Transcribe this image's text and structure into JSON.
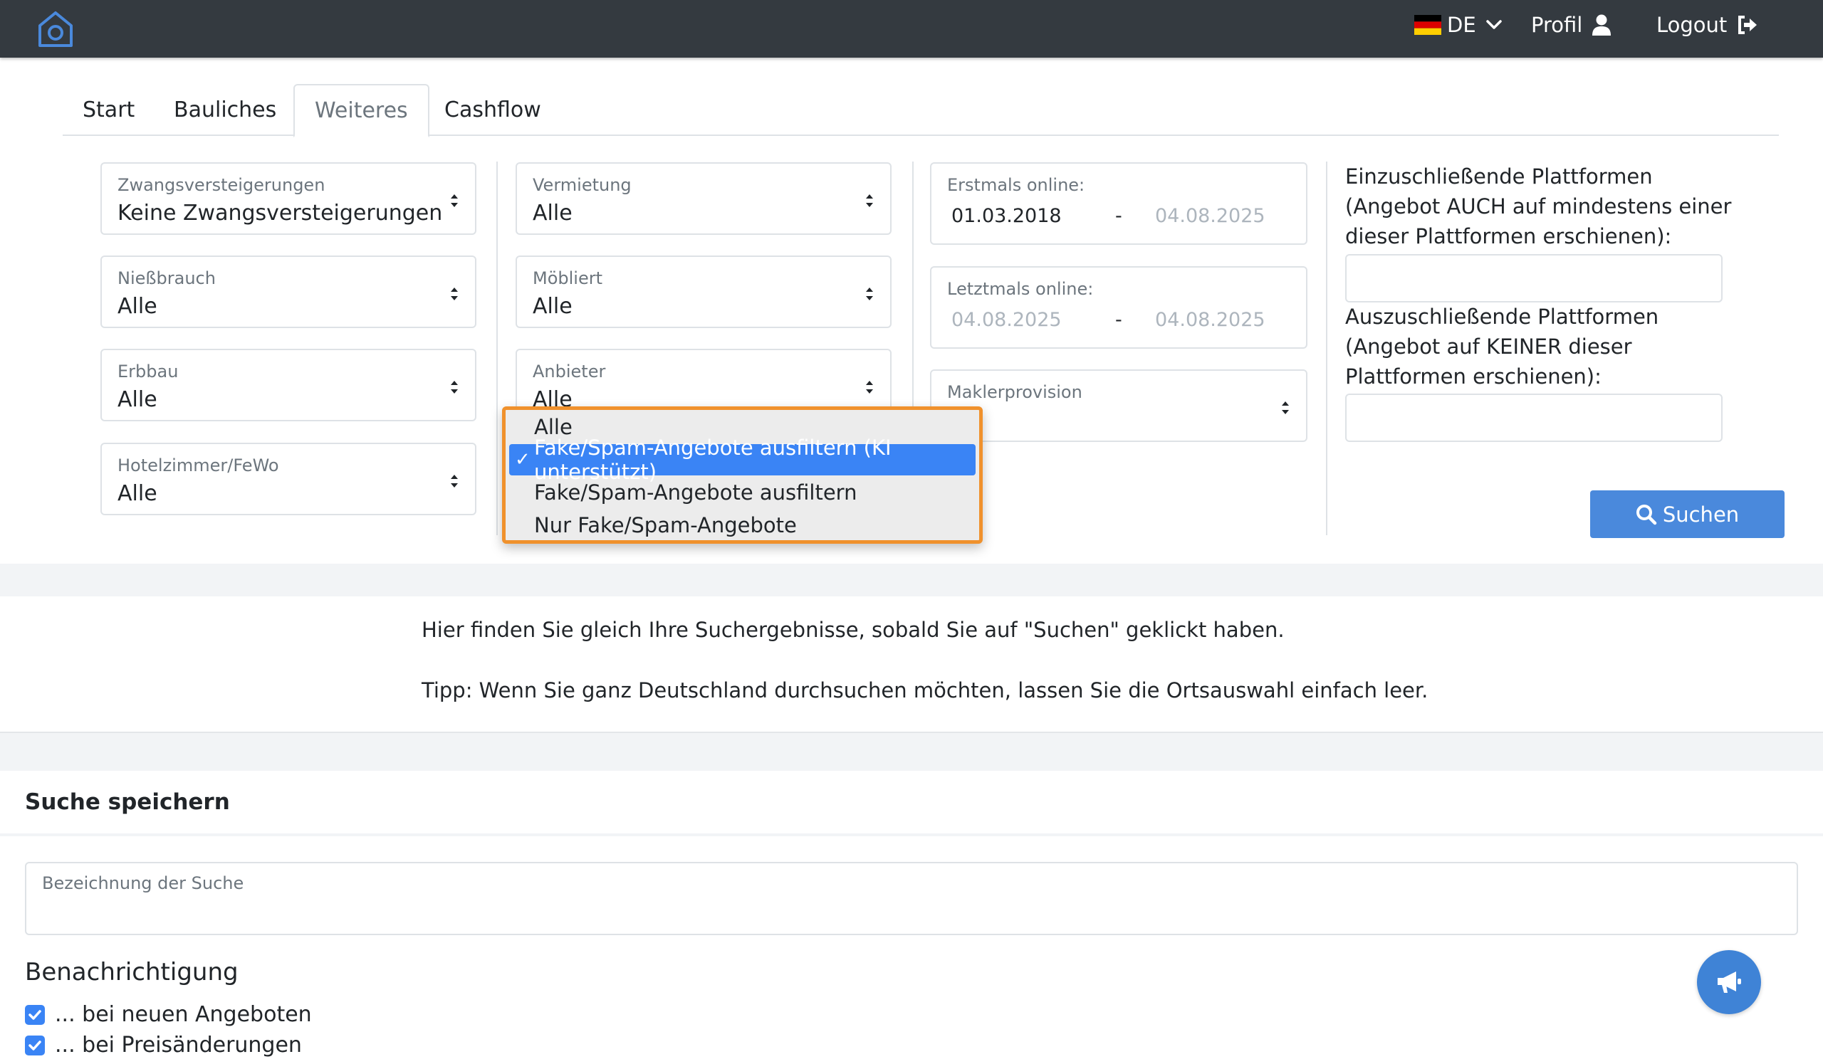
{
  "nav": {
    "language": "DE",
    "profile_label": "Profil",
    "logout_label": "Logout",
    "icons": [
      "house-logo-icon",
      "german-flag-icon",
      "chevron-down-icon",
      "user-icon",
      "sign-out-icon"
    ]
  },
  "tabs": [
    {
      "label": "Start",
      "active": false
    },
    {
      "label": "Bauliches",
      "active": false
    },
    {
      "label": "Weiteres",
      "active": true
    },
    {
      "label": "Cashflow",
      "active": false
    }
  ],
  "filters": {
    "zwangsversteigerungen": {
      "label": "Zwangsversteigerungen",
      "value": "Keine Zwangsversteigerungen"
    },
    "niessbrauch": {
      "label": "Nießbrauch",
      "value": "Alle"
    },
    "erbbau": {
      "label": "Erbbau",
      "value": "Alle"
    },
    "hotelzimmer": {
      "label": "Hotelzimmer/FeWo",
      "value": "Alle"
    },
    "vermietung": {
      "label": "Vermietung",
      "value": "Alle"
    },
    "moebliert": {
      "label": "Möbliert",
      "value": "Alle"
    },
    "anbieter": {
      "label": "Anbieter",
      "value": "Alle"
    },
    "erstmals": {
      "label": "Erstmals online:",
      "from": "01.03.2018",
      "dash": "-",
      "to": "04.08.2025"
    },
    "letztmals": {
      "label": "Letztmals online:",
      "from": "04.08.2025",
      "dash": "-",
      "to": "04.08.2025"
    },
    "maklerprovision": {
      "label": "Maklerprovision",
      "value": ""
    }
  },
  "platforms": {
    "include_title": "Einzuschließende Plattformen (Angebot AUCH auf mindestens einer dieser Plattformen erschienen):",
    "exclude_title": "Auszuschließende Plattformen (Angebot auf KEINER dieser Plattformen erschienen):"
  },
  "search_button": "Suchen",
  "dropdown": {
    "check_mark": "✓",
    "options": [
      {
        "label": "Alle",
        "selected": false
      },
      {
        "label": "Fake/Spam-Angebote ausfiltern (KI unterstützt)",
        "selected": true
      },
      {
        "label": "Fake/Spam-Angebote ausfiltern",
        "selected": false
      },
      {
        "label": "Nur Fake/Spam-Angebote",
        "selected": false
      }
    ]
  },
  "info": {
    "line1": "Hier finden Sie gleich Ihre Suchergebnisse, sobald Sie auf \"Suchen\" geklickt haben.",
    "line2": "Tipp: Wenn Sie ganz Deutschland durchsuchen möchten, lassen Sie die Ortsauswahl einfach leer."
  },
  "save": {
    "title": "Suche speichern",
    "name_label": "Bezeichnung der Suche",
    "notification_title": "Benachrichtigung",
    "checkboxes": [
      {
        "label": "... bei neuen Angeboten",
        "checked": true
      },
      {
        "label": "... bei Preisänderungen",
        "checked": true
      }
    ]
  },
  "colors": {
    "navbar": "#343a40",
    "accent": "#4a89dc",
    "dropdown_highlight": "#f0912c",
    "selected_option": "#3a84f5"
  }
}
